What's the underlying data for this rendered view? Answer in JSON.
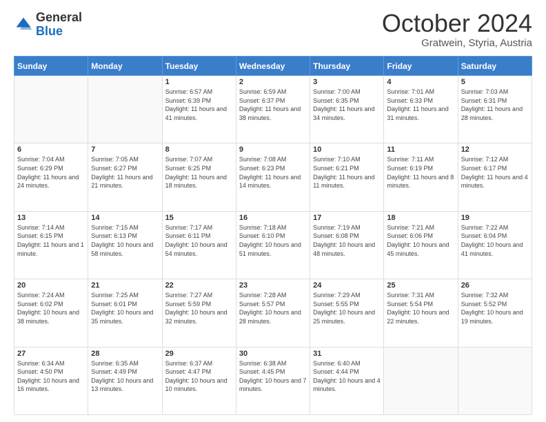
{
  "header": {
    "logo_general": "General",
    "logo_blue": "Blue",
    "month": "October 2024",
    "location": "Gratwein, Styria, Austria"
  },
  "weekdays": [
    "Sunday",
    "Monday",
    "Tuesday",
    "Wednesday",
    "Thursday",
    "Friday",
    "Saturday"
  ],
  "weeks": [
    [
      {
        "day": "",
        "sunrise": "",
        "sunset": "",
        "daylight": ""
      },
      {
        "day": "",
        "sunrise": "",
        "sunset": "",
        "daylight": ""
      },
      {
        "day": "1",
        "sunrise": "Sunrise: 6:57 AM",
        "sunset": "Sunset: 6:39 PM",
        "daylight": "Daylight: 11 hours and 41 minutes."
      },
      {
        "day": "2",
        "sunrise": "Sunrise: 6:59 AM",
        "sunset": "Sunset: 6:37 PM",
        "daylight": "Daylight: 11 hours and 38 minutes."
      },
      {
        "day": "3",
        "sunrise": "Sunrise: 7:00 AM",
        "sunset": "Sunset: 6:35 PM",
        "daylight": "Daylight: 11 hours and 34 minutes."
      },
      {
        "day": "4",
        "sunrise": "Sunrise: 7:01 AM",
        "sunset": "Sunset: 6:33 PM",
        "daylight": "Daylight: 11 hours and 31 minutes."
      },
      {
        "day": "5",
        "sunrise": "Sunrise: 7:03 AM",
        "sunset": "Sunset: 6:31 PM",
        "daylight": "Daylight: 11 hours and 28 minutes."
      }
    ],
    [
      {
        "day": "6",
        "sunrise": "Sunrise: 7:04 AM",
        "sunset": "Sunset: 6:29 PM",
        "daylight": "Daylight: 11 hours and 24 minutes."
      },
      {
        "day": "7",
        "sunrise": "Sunrise: 7:05 AM",
        "sunset": "Sunset: 6:27 PM",
        "daylight": "Daylight: 11 hours and 21 minutes."
      },
      {
        "day": "8",
        "sunrise": "Sunrise: 7:07 AM",
        "sunset": "Sunset: 6:25 PM",
        "daylight": "Daylight: 11 hours and 18 minutes."
      },
      {
        "day": "9",
        "sunrise": "Sunrise: 7:08 AM",
        "sunset": "Sunset: 6:23 PM",
        "daylight": "Daylight: 11 hours and 14 minutes."
      },
      {
        "day": "10",
        "sunrise": "Sunrise: 7:10 AM",
        "sunset": "Sunset: 6:21 PM",
        "daylight": "Daylight: 11 hours and 11 minutes."
      },
      {
        "day": "11",
        "sunrise": "Sunrise: 7:11 AM",
        "sunset": "Sunset: 6:19 PM",
        "daylight": "Daylight: 11 hours and 8 minutes."
      },
      {
        "day": "12",
        "sunrise": "Sunrise: 7:12 AM",
        "sunset": "Sunset: 6:17 PM",
        "daylight": "Daylight: 11 hours and 4 minutes."
      }
    ],
    [
      {
        "day": "13",
        "sunrise": "Sunrise: 7:14 AM",
        "sunset": "Sunset: 6:15 PM",
        "daylight": "Daylight: 11 hours and 1 minute."
      },
      {
        "day": "14",
        "sunrise": "Sunrise: 7:15 AM",
        "sunset": "Sunset: 6:13 PM",
        "daylight": "Daylight: 10 hours and 58 minutes."
      },
      {
        "day": "15",
        "sunrise": "Sunrise: 7:17 AM",
        "sunset": "Sunset: 6:11 PM",
        "daylight": "Daylight: 10 hours and 54 minutes."
      },
      {
        "day": "16",
        "sunrise": "Sunrise: 7:18 AM",
        "sunset": "Sunset: 6:10 PM",
        "daylight": "Daylight: 10 hours and 51 minutes."
      },
      {
        "day": "17",
        "sunrise": "Sunrise: 7:19 AM",
        "sunset": "Sunset: 6:08 PM",
        "daylight": "Daylight: 10 hours and 48 minutes."
      },
      {
        "day": "18",
        "sunrise": "Sunrise: 7:21 AM",
        "sunset": "Sunset: 6:06 PM",
        "daylight": "Daylight: 10 hours and 45 minutes."
      },
      {
        "day": "19",
        "sunrise": "Sunrise: 7:22 AM",
        "sunset": "Sunset: 6:04 PM",
        "daylight": "Daylight: 10 hours and 41 minutes."
      }
    ],
    [
      {
        "day": "20",
        "sunrise": "Sunrise: 7:24 AM",
        "sunset": "Sunset: 6:02 PM",
        "daylight": "Daylight: 10 hours and 38 minutes."
      },
      {
        "day": "21",
        "sunrise": "Sunrise: 7:25 AM",
        "sunset": "Sunset: 6:01 PM",
        "daylight": "Daylight: 10 hours and 35 minutes."
      },
      {
        "day": "22",
        "sunrise": "Sunrise: 7:27 AM",
        "sunset": "Sunset: 5:59 PM",
        "daylight": "Daylight: 10 hours and 32 minutes."
      },
      {
        "day": "23",
        "sunrise": "Sunrise: 7:28 AM",
        "sunset": "Sunset: 5:57 PM",
        "daylight": "Daylight: 10 hours and 28 minutes."
      },
      {
        "day": "24",
        "sunrise": "Sunrise: 7:29 AM",
        "sunset": "Sunset: 5:55 PM",
        "daylight": "Daylight: 10 hours and 25 minutes."
      },
      {
        "day": "25",
        "sunrise": "Sunrise: 7:31 AM",
        "sunset": "Sunset: 5:54 PM",
        "daylight": "Daylight: 10 hours and 22 minutes."
      },
      {
        "day": "26",
        "sunrise": "Sunrise: 7:32 AM",
        "sunset": "Sunset: 5:52 PM",
        "daylight": "Daylight: 10 hours and 19 minutes."
      }
    ],
    [
      {
        "day": "27",
        "sunrise": "Sunrise: 6:34 AM",
        "sunset": "Sunset: 4:50 PM",
        "daylight": "Daylight: 10 hours and 16 minutes."
      },
      {
        "day": "28",
        "sunrise": "Sunrise: 6:35 AM",
        "sunset": "Sunset: 4:49 PM",
        "daylight": "Daylight: 10 hours and 13 minutes."
      },
      {
        "day": "29",
        "sunrise": "Sunrise: 6:37 AM",
        "sunset": "Sunset: 4:47 PM",
        "daylight": "Daylight: 10 hours and 10 minutes."
      },
      {
        "day": "30",
        "sunrise": "Sunrise: 6:38 AM",
        "sunset": "Sunset: 4:45 PM",
        "daylight": "Daylight: 10 hours and 7 minutes."
      },
      {
        "day": "31",
        "sunrise": "Sunrise: 6:40 AM",
        "sunset": "Sunset: 4:44 PM",
        "daylight": "Daylight: 10 hours and 4 minutes."
      },
      {
        "day": "",
        "sunrise": "",
        "sunset": "",
        "daylight": ""
      },
      {
        "day": "",
        "sunrise": "",
        "sunset": "",
        "daylight": ""
      }
    ]
  ]
}
